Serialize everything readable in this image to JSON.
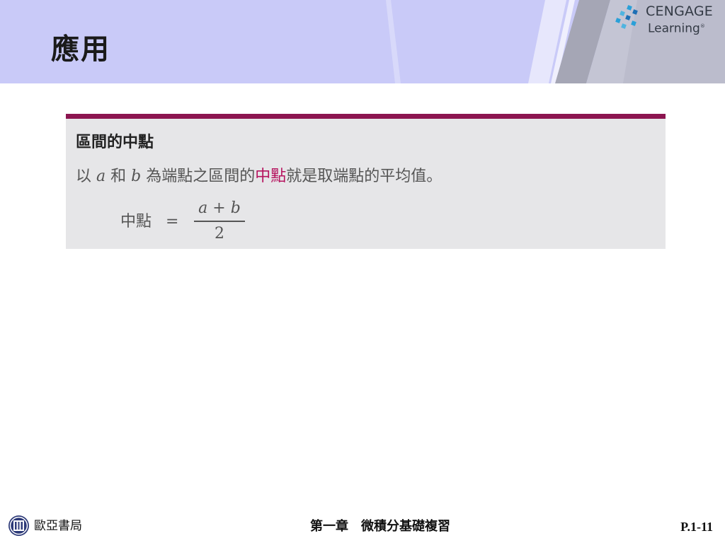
{
  "slide": {
    "title": "應用"
  },
  "logo": {
    "brand": "CENGAGE",
    "sub": "Learning",
    "mark": "®"
  },
  "definition": {
    "heading": "區間的中點",
    "text_before": "以",
    "var_a": "a",
    "text_and": "和",
    "var_b": "b",
    "text_mid": "為端點之區間的",
    "highlight": "中點",
    "text_after": "就是取端點的平均值。",
    "formula": {
      "lhs": "中點",
      "eq": "=",
      "num_a": "a",
      "num_op": "+",
      "num_b": "b",
      "den": "2"
    }
  },
  "footer": {
    "publisher": "歐亞書局",
    "chapter": "第一章　微積分基礎複習",
    "page": "P.1-11"
  },
  "colors": {
    "header_bg": "#c9caf8",
    "accent_bar": "#8c1550",
    "highlight": "#b5135e",
    "box_bg": "#e6e6e8"
  }
}
